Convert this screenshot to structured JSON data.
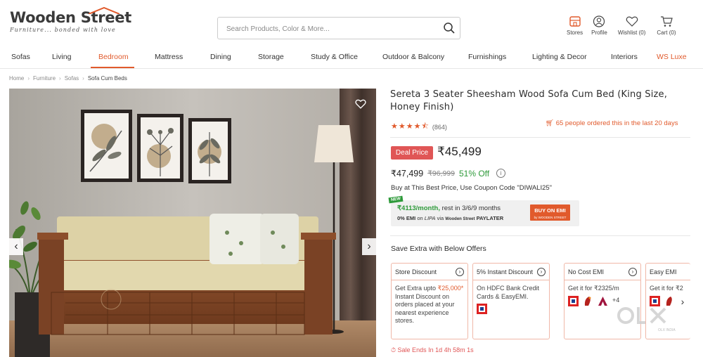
{
  "header": {
    "logo_text": "Wooden Street",
    "logo_tagline": "Furniture... bonded with love",
    "search_placeholder": "Search Products, Color & More...",
    "icons": [
      {
        "label": "Stores",
        "icon": "store-icon"
      },
      {
        "label": "Profile",
        "icon": "profile-icon"
      },
      {
        "label": "Wishlist (0)",
        "icon": "heart-icon"
      },
      {
        "label": "Cart (0)",
        "icon": "cart-icon"
      }
    ]
  },
  "nav": {
    "items": [
      "Sofas",
      "Living",
      "Bedroom",
      "Mattress",
      "Dining",
      "Storage",
      "Study & Office",
      "Outdoor & Balcony",
      "Furnishings",
      "Lighting & Decor",
      "Interiors",
      "WS Luxe"
    ],
    "active": "Bedroom"
  },
  "breadcrumb": [
    "Home",
    "Furniture",
    "Sofas",
    "Sofa Cum Beds"
  ],
  "product": {
    "title": "Sereta 3 Seater Sheesham Wood Sofa Cum Bed (King Size, Honey Finish)",
    "rating": 4.5,
    "reviews": "(864)",
    "ordered_text": "65 people ordered this in the last 20 days",
    "deal_label": "Deal Price",
    "deal_price": "₹45,499",
    "price": "₹47,499",
    "mrp": "₹96,999",
    "discount": "51% Off",
    "coupon_text": "Buy at This Best Price, Use Coupon Code \"DIWALI25\""
  },
  "emi": {
    "new_tag": "NEW",
    "amount": "₹4113/month,",
    "terms": "rest in 3/6/9 months",
    "zero_emi": "0% EMI",
    "on": "on",
    "via": "via",
    "brand1": "LIPA",
    "brand2": "Wooden Street",
    "brand3": "PAYLATER",
    "button": "BUY ON EMI",
    "button_sub": "by WOODEN STREET"
  },
  "offers": {
    "heading": "Save Extra with Below Offers",
    "cards": [
      {
        "title": "Store Discount",
        "body_pre": "Get Extra upto ",
        "highlight": "₹25,000*",
        "body_post": " Instant Discount on orders placed at your nearest experience stores."
      },
      {
        "title": "5% Instant Discount",
        "body": "On HDFC Bank Credit Cards & EasyEMI."
      },
      {
        "title": "No Cost EMI",
        "body": "Get it for ₹2325/m",
        "extra": "+4"
      },
      {
        "title": "Easy EMI",
        "body": "Get it for ₹2"
      }
    ]
  },
  "sale_text": "Sale Ends In 1d 4h 58m 1s",
  "watermark": "OLX INDIA"
}
